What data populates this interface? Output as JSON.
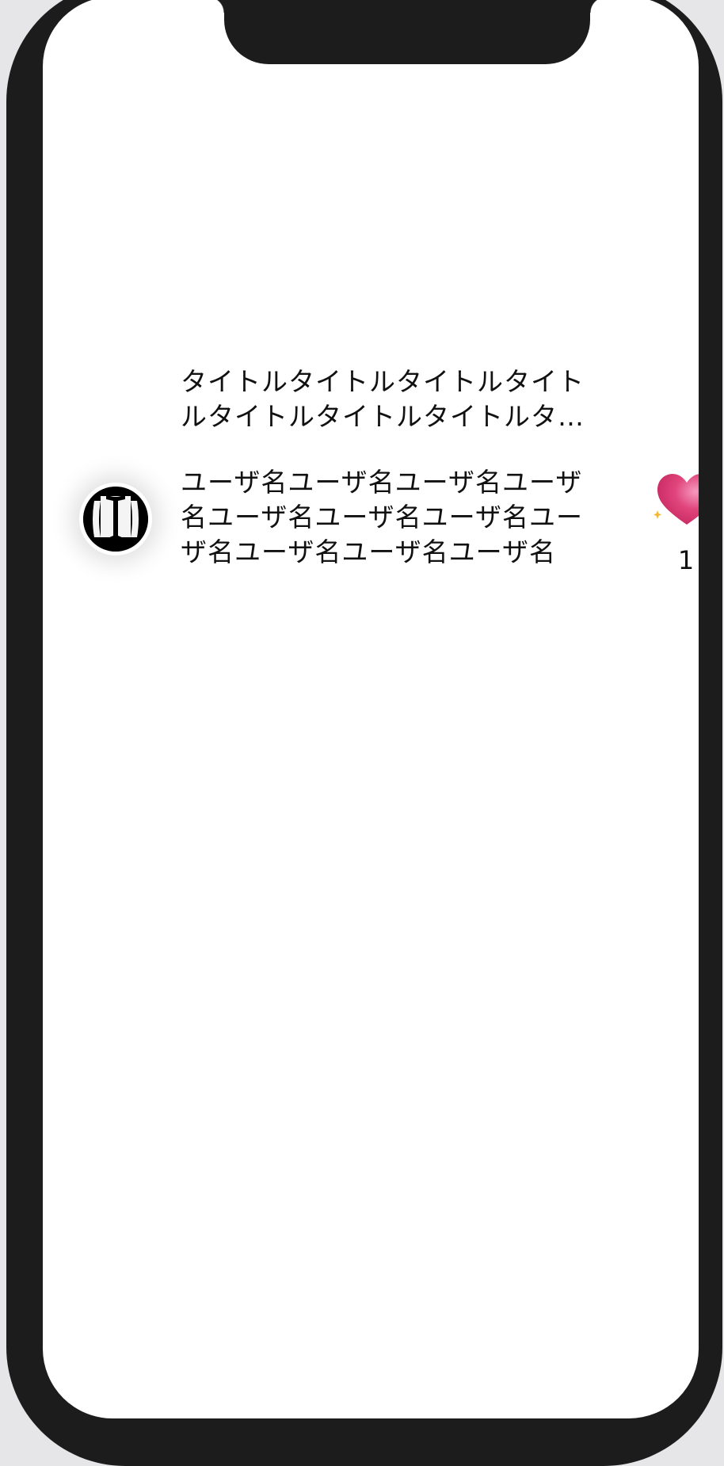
{
  "post": {
    "title": "タイトルタイトルタイトルタイトルタイトルタイトルタイトルタイトルタイトル",
    "username": "ユーザ名ユーザ名ユーザ名ユーザ名ユーザ名ユーザ名ユーザ名ユーザ名ユーザ名ユーザ名ユーザ名",
    "like_count": "1",
    "like_icon": "sparkling-heart-icon",
    "avatar_icon": "avatar-icon"
  },
  "colors": {
    "frame": "#1c1c1c",
    "screen": "#ffffff",
    "heart": "#e0457b",
    "sparkle": "#f5b82e"
  }
}
